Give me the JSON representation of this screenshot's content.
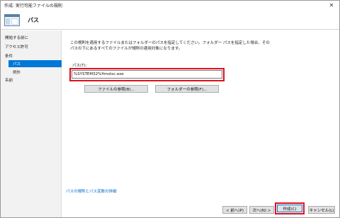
{
  "window": {
    "title": "作成: 実行可能ファイルの規則",
    "close_glyph": "✕"
  },
  "header": {
    "title": "パス"
  },
  "sidebar": {
    "items": [
      {
        "label": "開始する前に"
      },
      {
        "label": "アクセス許可"
      },
      {
        "label": "条件"
      },
      {
        "label": "パス",
        "selected": true
      },
      {
        "label": "例外"
      },
      {
        "label": "名前"
      }
    ]
  },
  "main": {
    "description_line1": "この規則を適用するファイルまたはフォルダーのパスを指定してください。フォルダー パスを指定した場合、その",
    "description_line2": "パスの下にあるすべてのファイルが規則の適用対象になります。",
    "path_label": "パス(T):",
    "path_value": "%SYSTEM32%¥mstsc.exe",
    "browse_files_label": "ファイルの参照(B)...",
    "browse_folders_label": "フォルダーの参照(F)...",
    "help_link": "パスの規則とパス変数の詳細"
  },
  "footer": {
    "back_label": "< 前へ(P)",
    "next_label": "次へ(N) >",
    "create_label": "作成(C)",
    "cancel_label": "キャンセル(L)"
  },
  "colors": {
    "accent": "#0078d7",
    "highlight": "#e0101e",
    "link": "#0066cc"
  }
}
